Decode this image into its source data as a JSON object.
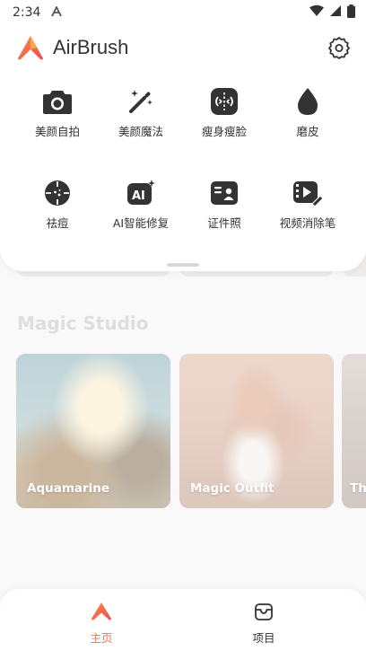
{
  "status_bar": {
    "time": "2:34",
    "notification_icon": "a-icon",
    "icons": [
      "wifi-icon",
      "signal-icon",
      "battery-icon"
    ]
  },
  "header": {
    "app_name": "AirBrush",
    "logo_icon": "airbrush-logo-icon",
    "settings_icon": "gear-icon"
  },
  "tools": [
    {
      "label": "美颜自拍",
      "icon": "camera-icon"
    },
    {
      "label": "美颜魔法",
      "icon": "magic-wand-icon"
    },
    {
      "label": "瘦身瘦脸",
      "icon": "slim-icon"
    },
    {
      "label": "磨皮",
      "icon": "drop-icon"
    },
    {
      "label": "祛痘",
      "icon": "acne-icon"
    },
    {
      "label": "AI智能修复",
      "icon": "ai-repair-icon"
    },
    {
      "label": "证件照",
      "icon": "id-photo-icon"
    },
    {
      "label": "视频消除笔",
      "icon": "video-eraser-icon"
    }
  ],
  "magic_studio": {
    "title": "Magic Studio",
    "cards": [
      {
        "label": "Aquamarine"
      },
      {
        "label": "Magic Outfit"
      },
      {
        "label": "Th"
      }
    ]
  },
  "bottom_nav": {
    "items": [
      {
        "label": "主页",
        "icon": "home-logo-icon",
        "active": true
      },
      {
        "label": "项目",
        "icon": "project-box-icon",
        "active": false
      }
    ]
  },
  "colors": {
    "accent": "#f2733a",
    "text_primary": "#333333",
    "section_title_dimmed": "#d2d2d2"
  }
}
